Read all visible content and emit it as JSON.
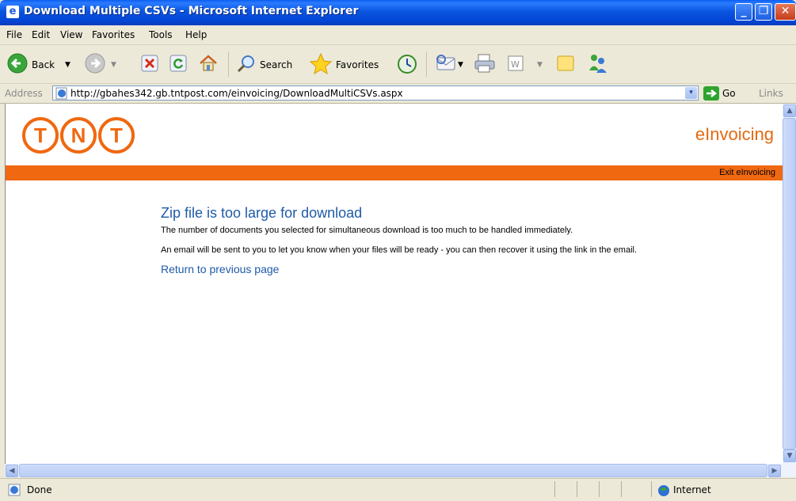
{
  "window": {
    "title": "Download Multiple CSVs - Microsoft Internet Explorer",
    "min_glyph": "_",
    "max_glyph": "❐",
    "close_glyph": "✕"
  },
  "menu": [
    "File",
    "Edit",
    "View",
    "Favorites",
    "Tools",
    "Help"
  ],
  "toolbar": {
    "back_label": "Back",
    "search_label": "Search",
    "favorites_label": "Favorites"
  },
  "address": {
    "label": "Address",
    "url": "http://gbahes342.gb.tntpost.com/einvoicing/DownloadMultiCSVs.aspx",
    "dropdown_glyph": "▾",
    "go_label": "Go",
    "links_label": "Links"
  },
  "page": {
    "logo_letters": [
      "T",
      "N",
      "T"
    ],
    "brand_title": "eInvoicing",
    "exit_link": "Exit eInvoicing",
    "message_title": "Zip file is too large for download",
    "message_line1": "The number of documents you selected for simultaneous download is too much to be handled immediately.",
    "message_line2": "An email will be sent to you to let you know when your files will be ready - you can then recover it using the link in the email.",
    "return_link": "Return to previous page"
  },
  "scroll": {
    "up": "▲",
    "down": "▼",
    "left": "◀",
    "right": "▶"
  },
  "status": {
    "text": "Done",
    "zone": "Internet"
  },
  "colors": {
    "tnt_orange": "#f06810",
    "link_blue": "#1f5aa8",
    "xp_title_blue": "#0a55e0"
  }
}
